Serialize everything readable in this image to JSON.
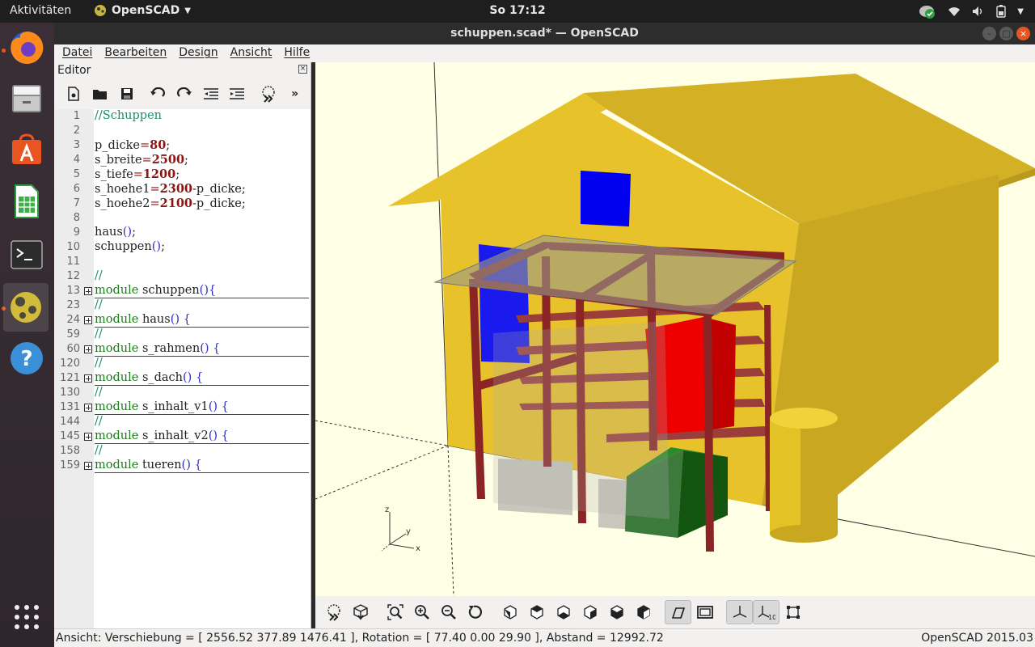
{
  "topbar": {
    "activities": "Aktivitäten",
    "app_name": "OpenSCAD",
    "clock": "So 17:12"
  },
  "dock": {
    "items": [
      {
        "name": "firefox-icon",
        "running": true
      },
      {
        "name": "files-icon",
        "running": false
      },
      {
        "name": "software-center-icon",
        "running": false
      },
      {
        "name": "calc-icon",
        "running": false
      },
      {
        "name": "terminal-icon",
        "running": false
      },
      {
        "name": "openscad-icon",
        "running": true
      },
      {
        "name": "help-icon",
        "running": false
      }
    ]
  },
  "window": {
    "title": "schuppen.scad* — OpenSCAD"
  },
  "menu": [
    "Datei",
    "Bearbeiten",
    "Design",
    "Ansicht",
    "Hilfe"
  ],
  "editor": {
    "title": "Editor",
    "lines": [
      {
        "n": "1",
        "text": "//Schuppen",
        "type": "comment"
      },
      {
        "n": "2",
        "text": "",
        "type": "plain"
      },
      {
        "n": "3",
        "name": "p_dicke",
        "value": "80",
        "rest": "",
        "type": "assign"
      },
      {
        "n": "4",
        "name": "s_breite",
        "value": "2500",
        "rest": "",
        "type": "assign"
      },
      {
        "n": "5",
        "name": "s_tiefe",
        "value": "1200",
        "rest": "",
        "type": "assign"
      },
      {
        "n": "6",
        "name": "s_hoehe1",
        "value": "2300",
        "rest": "-p_dicke",
        "type": "assign"
      },
      {
        "n": "7",
        "name": "s_hoehe2",
        "value": "2100",
        "rest": "-p_dicke",
        "type": "assign"
      },
      {
        "n": "8",
        "text": "",
        "type": "plain"
      },
      {
        "n": "9",
        "name": "haus",
        "type": "call"
      },
      {
        "n": "10",
        "name": "schuppen",
        "type": "call"
      },
      {
        "n": "11",
        "text": "",
        "type": "plain"
      },
      {
        "n": "12",
        "text": "//",
        "type": "comment"
      },
      {
        "n": "13",
        "name": "schuppen",
        "space": false,
        "type": "module"
      },
      {
        "n": "23",
        "text": "//",
        "type": "comment"
      },
      {
        "n": "24",
        "name": "haus",
        "space": true,
        "type": "module"
      },
      {
        "n": "59",
        "text": "//",
        "type": "comment"
      },
      {
        "n": "60",
        "name": "s_rahmen",
        "space": true,
        "type": "module"
      },
      {
        "n": "120",
        "text": "//",
        "type": "comment"
      },
      {
        "n": "121",
        "name": "s_dach",
        "space": true,
        "type": "module"
      },
      {
        "n": "130",
        "text": "//",
        "type": "comment"
      },
      {
        "n": "131",
        "name": "s_inhalt_v1",
        "space": true,
        "type": "module"
      },
      {
        "n": "144",
        "text": "//",
        "type": "comment"
      },
      {
        "n": "145",
        "name": "s_inhalt_v2",
        "space": true,
        "type": "module"
      },
      {
        "n": "158",
        "text": "//",
        "type": "comment"
      },
      {
        "n": "159",
        "name": "tueren",
        "space": true,
        "type": "module"
      }
    ]
  },
  "syntax": {
    "module_kw": "module",
    "open_brace": "{",
    "parens": "()",
    "semicolon": ";",
    "equals": "="
  },
  "statusbar": {
    "left": "Ansicht: Verschiebung = [ 2556.52 377.89 1476.41 ], Rotation = [ 77.40 0.00 29.90 ], Abstand = 12992.72",
    "right": "OpenSCAD 2015.03"
  },
  "viewport": {
    "axis_z": "z",
    "axis_x": "x",
    "axis_y": "y",
    "background": "#ffffe5"
  },
  "colors": {
    "wall": "#e8c22a",
    "roof": "#d9b526",
    "frame": "#8b2525",
    "window_blue": "#0000ee",
    "box_red": "#ee0000",
    "box_green": "#1f7a1f",
    "barrel": "#e3c226"
  }
}
